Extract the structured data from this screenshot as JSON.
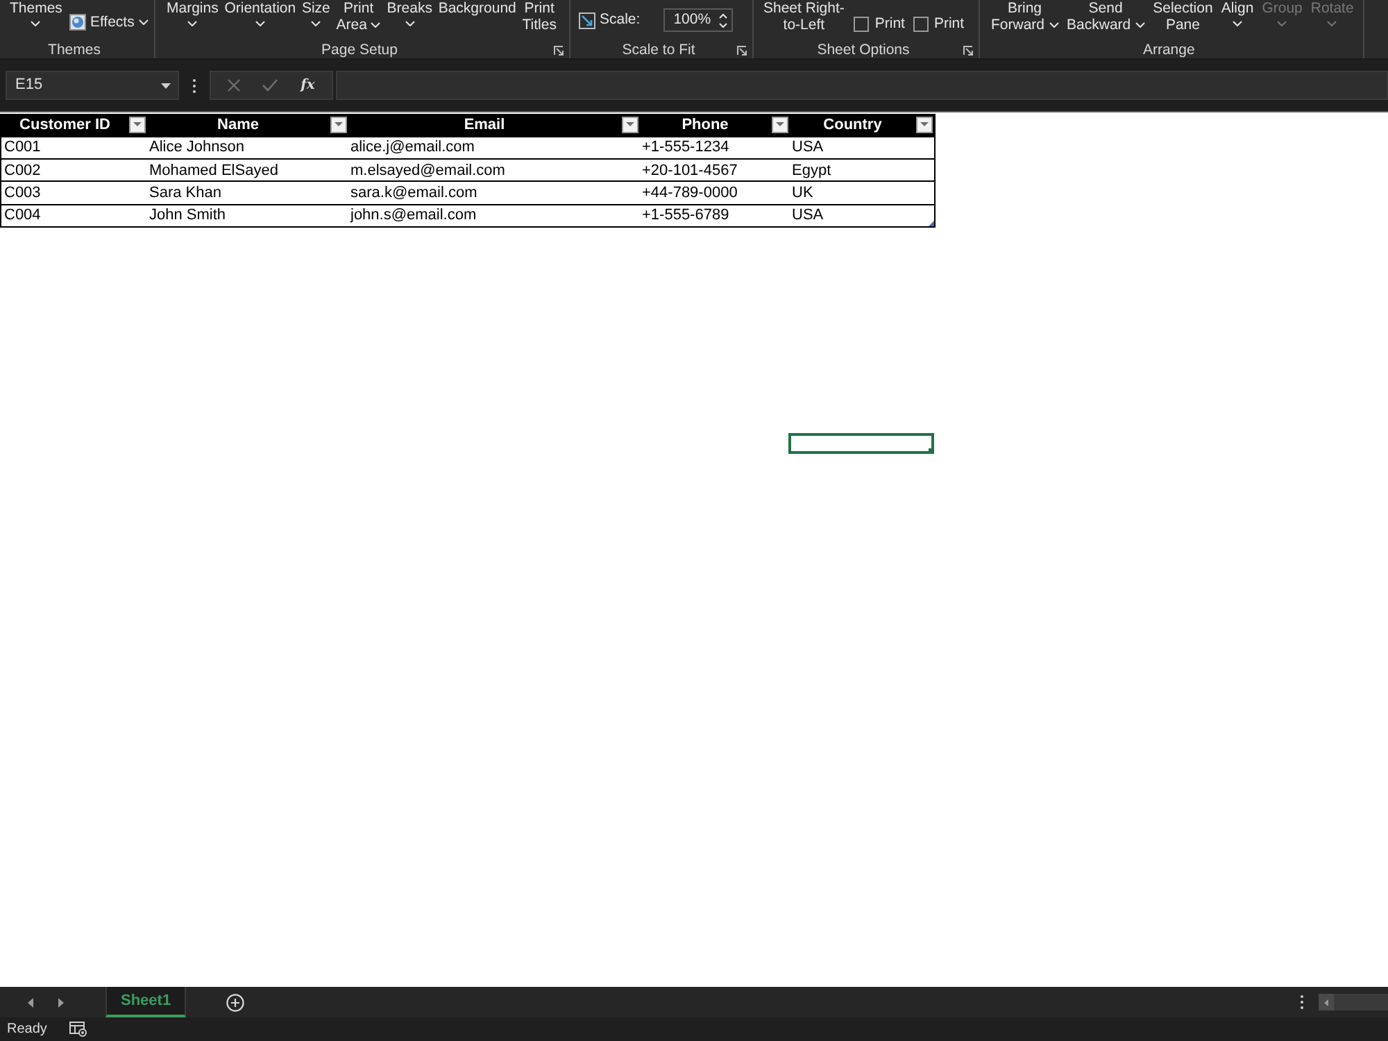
{
  "ribbon": {
    "groups": [
      {
        "label": "Themes",
        "launcher": false,
        "items": [
          {
            "kind": "menu",
            "lines": [
              "Themes"
            ],
            "disabled": false
          },
          {
            "kind": "smallmenu",
            "label": "Effects",
            "disabled": false
          }
        ]
      },
      {
        "label": "Page Setup",
        "launcher": true,
        "items": [
          {
            "kind": "menu",
            "lines": [
              "Margins"
            ],
            "disabled": false
          },
          {
            "kind": "menu",
            "lines": [
              "Orientation"
            ],
            "disabled": false
          },
          {
            "kind": "menu",
            "lines": [
              "Size"
            ],
            "disabled": false
          },
          {
            "kind": "inlinemenu",
            "lines": [
              "Print",
              "Area"
            ],
            "disabled": false
          },
          {
            "kind": "menu",
            "lines": [
              "Breaks"
            ],
            "disabled": false
          },
          {
            "kind": "button",
            "lines": [
              "Background"
            ],
            "disabled": false
          },
          {
            "kind": "button",
            "lines": [
              "Print",
              "Titles"
            ],
            "disabled": false
          }
        ]
      },
      {
        "label": "Scale to Fit",
        "launcher": true,
        "items": [
          {
            "kind": "spinner",
            "label": "Scale:",
            "value": "100%",
            "disabled": false
          }
        ]
      },
      {
        "label": "Sheet Options",
        "launcher": true,
        "items": [
          {
            "kind": "button",
            "lines": [
              "Sheet Right-",
              "to-Left"
            ],
            "disabled": false
          },
          {
            "kind": "checkbox",
            "label": "Print",
            "checked": false,
            "disabled": false
          },
          {
            "kind": "checkbox",
            "label": "Print",
            "checked": false,
            "disabled": false
          }
        ]
      },
      {
        "label": "Arrange",
        "launcher": false,
        "items": [
          {
            "kind": "inlinemenu",
            "lines": [
              "Bring",
              "Forward"
            ],
            "disabled": false
          },
          {
            "kind": "inlinemenu",
            "lines": [
              "Send",
              "Backward"
            ],
            "disabled": false
          },
          {
            "kind": "button",
            "lines": [
              "Selection",
              "Pane"
            ],
            "disabled": false
          },
          {
            "kind": "menu",
            "lines": [
              "Align"
            ],
            "disabled": false
          },
          {
            "kind": "menu",
            "lines": [
              "Group"
            ],
            "disabled": true
          },
          {
            "kind": "menu",
            "lines": [
              "Rotate"
            ],
            "disabled": true
          }
        ]
      }
    ]
  },
  "formula_bar": {
    "name_box": "E15",
    "insert_function": "fx",
    "editing": false
  },
  "table": {
    "columns": [
      {
        "label": "Customer ID",
        "filter": true
      },
      {
        "label": "Name",
        "filter": true
      },
      {
        "label": "Email",
        "filter": true
      },
      {
        "label": "Phone",
        "filter": true
      },
      {
        "label": "Country",
        "filter": true
      }
    ],
    "rows": [
      [
        "C001",
        "Alice Johnson",
        "alice.j@email.com",
        "+1-555-1234",
        "USA"
      ],
      [
        "C002",
        "Mohamed ElSayed",
        "m.elsayed@email.com",
        "+20-101-4567",
        "Egypt"
      ],
      [
        "C003",
        "Sara Khan",
        "sara.k@email.com",
        "+44-789-0000",
        "UK"
      ],
      [
        "C004",
        "John Smith",
        "john.s@email.com",
        "+1-555-6789",
        "USA"
      ]
    ]
  },
  "sheet_tabs": [
    {
      "label": "Sheet1",
      "selected": true
    }
  ],
  "status_bar": {
    "text": "Ready"
  }
}
